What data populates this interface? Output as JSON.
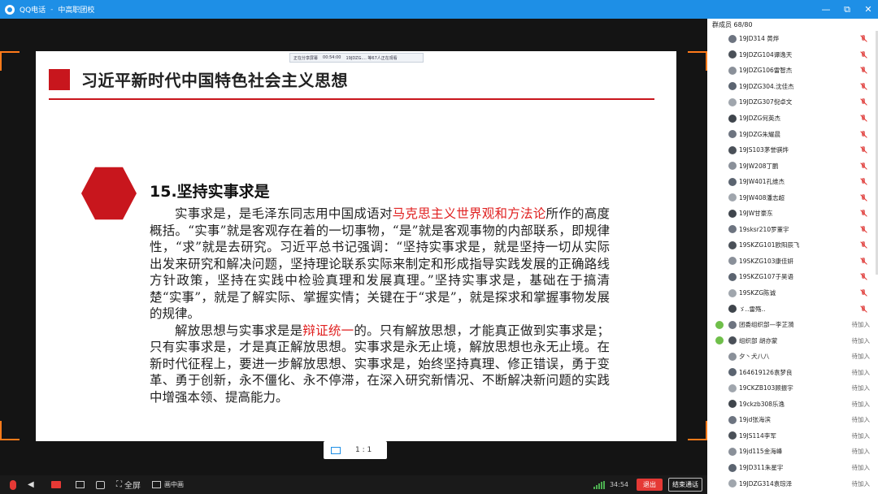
{
  "window": {
    "app_name": "QQ电话",
    "group_name": "中高职团校",
    "buttons": [
      "—",
      "⧉",
      "✕"
    ]
  },
  "share_bar": {
    "status": "正在分享屏幕",
    "time": "00:54:00",
    "info": "19JDZG.... 等67人正在观看"
  },
  "slide": {
    "title": "习近平新时代中国特色社会主义思想",
    "section_title": "15.坚持实事求是",
    "paragraph1": {
      "before": "实事求是，是毛泽东同志用中国成语对",
      "highlight": "马克思主义世界观和方法论",
      "after": "所作的高度概括。“实事”就是客观存在着的一切事物，“是”就是客观事物的内部联系，即规律性，“求”就是去研究。习近平总书记强调：“坚持实事求是，就是坚持一切从实际出发来研究和解决问题，坚持理论联系实际来制定和形成指导实践发展的正确路线方针政策，坚持在实践中检验真理和发展真理。”坚持实事求是，基础在于搞清楚“实事”，就是了解实际、掌握实情；关键在于“求是”，就是探求和掌握事物发展的规律。"
    },
    "paragraph2": {
      "before": "解放思想与实事求是是",
      "highlight": "辩证统一",
      "after": "的。只有解放思想，才能真正做到实事求是；只有实事求是，才是真正解放思想。实事求是永无止境，解放思想也永无止境。在新时代征程上，要进一步解放思想、实事求是，始终坚持真理、修正错误，勇于变革、勇于创新，永不僵化、永不停滞，在深入研究新情况、不断解决新问题的实践中增强本领、提高能力。"
    }
  },
  "zoom": {
    "ratio": "1 : 1"
  },
  "toolbar": {
    "fullscreen_label": "全屏",
    "pip_label": "画中画",
    "timer": "34:54",
    "exit_label": "退出",
    "end_label": "结束通话"
  },
  "members_panel": {
    "header": "群成员 68/80",
    "members": [
      {
        "name": "19JD314 黄烨",
        "status": "muted",
        "admin": false
      },
      {
        "name": "19JDZG104谭逸天",
        "status": "muted",
        "admin": false
      },
      {
        "name": "19JDZG106雷智杰",
        "status": "muted",
        "admin": false
      },
      {
        "name": "19JDZG304.沈佳杰",
        "status": "muted",
        "admin": false
      },
      {
        "name": "19JDZG307倪卓文",
        "status": "muted",
        "admin": false
      },
      {
        "name": "19JDZG何英杰",
        "status": "muted",
        "admin": false
      },
      {
        "name": "19JDZG朱耀晨",
        "status": "muted",
        "admin": false
      },
      {
        "name": "19JS103茅誉骐烨",
        "status": "muted",
        "admin": false
      },
      {
        "name": "19JW208丁鹏",
        "status": "muted",
        "admin": false
      },
      {
        "name": "19JW401孔维杰",
        "status": "muted",
        "admin": false
      },
      {
        "name": "19JW408潘志超",
        "status": "muted",
        "admin": false
      },
      {
        "name": "19JW甘豪东",
        "status": "muted",
        "admin": false
      },
      {
        "name": "19sksr210罗董宇",
        "status": "muted",
        "admin": false
      },
      {
        "name": "19SKZG101欧阳辰飞",
        "status": "muted",
        "admin": false
      },
      {
        "name": "19SKZG103康佳妍",
        "status": "muted",
        "admin": false
      },
      {
        "name": "19SKZG107于昊语",
        "status": "muted",
        "admin": false
      },
      {
        "name": "19SKZG陈诚",
        "status": "muted",
        "admin": false
      },
      {
        "name": "ゞ‥雷殇‥",
        "status": "muted",
        "admin": false
      },
      {
        "name": "团委组织部—李芷漪",
        "status": "待加入",
        "admin": true
      },
      {
        "name": "组织部 胡亦蒙",
        "status": "待加入",
        "admin": true
      },
      {
        "name": "夕丶犬八八",
        "status": "待加入",
        "admin": false
      },
      {
        "name": "164619126袁梦良",
        "status": "待加入",
        "admin": false
      },
      {
        "name": "19CKZB103顾振宇",
        "status": "待加入",
        "admin": false
      },
      {
        "name": "19ckzb308乐逸",
        "status": "待加入",
        "admin": false
      },
      {
        "name": "19jd张海滨",
        "status": "待加入",
        "admin": false
      },
      {
        "name": "19JS114李军",
        "status": "待加入",
        "admin": false
      },
      {
        "name": "19jd115金海峰",
        "status": "待加入",
        "admin": false
      },
      {
        "name": "19JD311朱星宇",
        "status": "待加入",
        "admin": false
      },
      {
        "name": "19JDZG314袁琮泽",
        "status": "待加入",
        "admin": false
      }
    ]
  },
  "colors": {
    "titlebar": "#1e8fe6",
    "accent_red": "#c8161d",
    "highlight_text": "#e02020",
    "corner_brackets": "#ff7a1a"
  }
}
